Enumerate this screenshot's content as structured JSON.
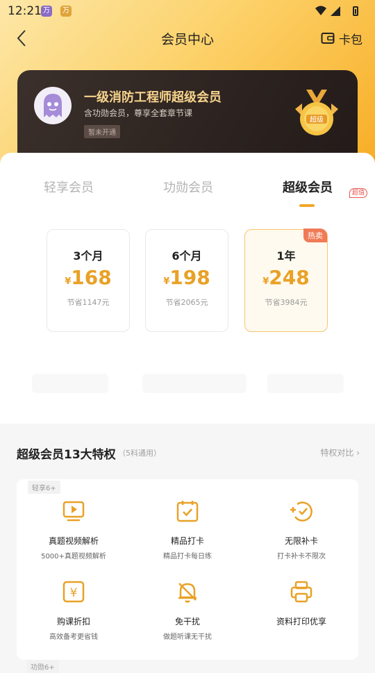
{
  "status_bar": {
    "time": "12:21",
    "app1": "万",
    "app2": "万"
  },
  "header": {
    "title": "会员中心",
    "wallet_label": "卡包"
  },
  "member_card": {
    "title": "一级消防工程师超级会员",
    "subtitle": "含功勋会员，尊享全套章节课",
    "badge": "暂未开通",
    "medal_text": "超级"
  },
  "tabs": [
    {
      "label": "轻享会员"
    },
    {
      "label": "功勋会员"
    },
    {
      "label": "超级会员",
      "active": true,
      "tag": "超值"
    }
  ],
  "plans": [
    {
      "duration": "3个月",
      "currency": "¥",
      "price": "168",
      "save": "节省1147元"
    },
    {
      "duration": "6个月",
      "currency": "¥",
      "price": "198",
      "save": "节省2065元"
    },
    {
      "duration": "1年",
      "currency": "¥",
      "price": "248",
      "save": "节省3984元",
      "tag": "热卖",
      "selected": true
    }
  ],
  "privileges": {
    "title": "超级会员13大特权",
    "note": "（5科通用）",
    "compare_label": "特权对比",
    "group1_tag": "轻享6+",
    "group2_tag": "功勋6+",
    "items": [
      {
        "name": "真题视频解析",
        "desc": "5000+真题视频解析",
        "icon": "video-play-icon"
      },
      {
        "name": "精品打卡",
        "desc": "精品打卡每日练",
        "icon": "calendar-check-icon"
      },
      {
        "name": "无限补卡",
        "desc": "打卡补卡不限次",
        "icon": "plus-check-icon"
      },
      {
        "name": "购课折扣",
        "desc": "高效备考更省钱",
        "icon": "yen-coupon-icon"
      },
      {
        "name": "免干扰",
        "desc": "做题听课无干扰",
        "icon": "bell-off-icon"
      },
      {
        "name": "资料打印优享",
        "desc": "",
        "icon": "printer-icon"
      }
    ]
  },
  "colors": {
    "accent": "#f0a72c",
    "price": "#e9a126",
    "hot": "#f07b57",
    "card_dark": "#2c2320",
    "card_gold": "#f7d48c"
  }
}
